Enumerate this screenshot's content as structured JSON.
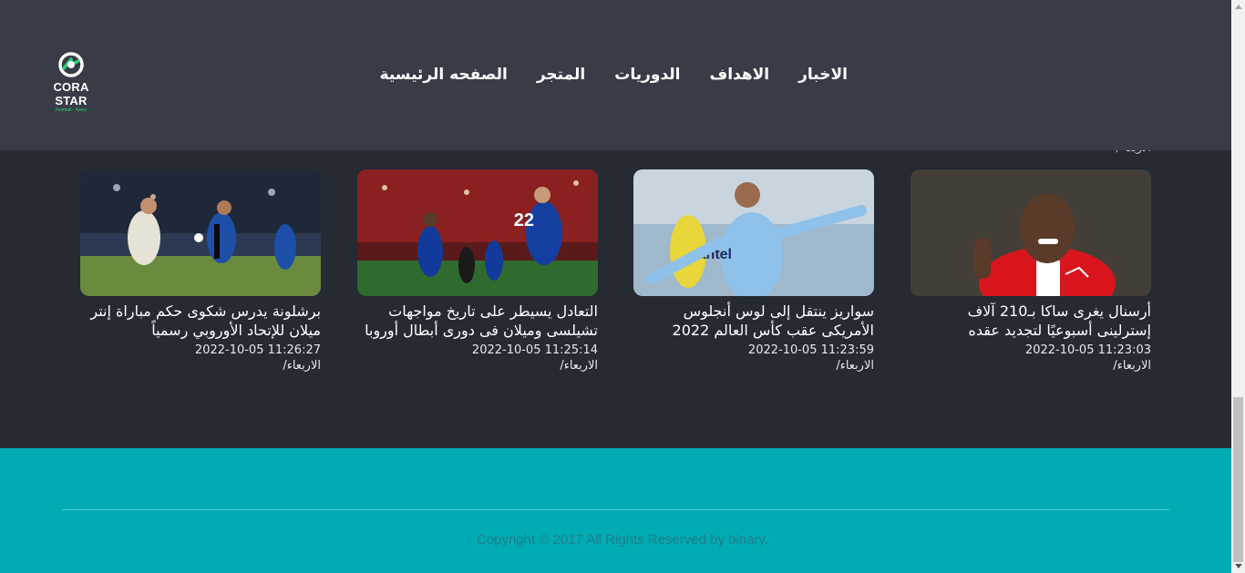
{
  "brand": {
    "name": "CORA STAR",
    "tagline": "Football - News"
  },
  "nav": [
    {
      "label": "الصفحه الرئيسية"
    },
    {
      "label": "المتجر"
    },
    {
      "label": "الدوريات"
    },
    {
      "label": "الاهداف"
    },
    {
      "label": "الاخبار"
    }
  ],
  "cutoff_text": "الاربعاء/",
  "cards": [
    {
      "title": "أرسنال يغرى ساكا بـ210 آلاف إسترلينى أسبوعيًا لتجديد عقده",
      "time": "2022-10-05 11:23:03",
      "day": "الاربعاء/"
    },
    {
      "title": "سواريز ينتقل إلى لوس أنجلوس الأمريكى عقب كأس العالم 2022",
      "time": "2022-10-05 11:23:59",
      "day": "الاربعاء/"
    },
    {
      "title": "التعادل يسيطر على تاريخ مواجهات تشيلسى وميلان فى دورى أبطال أوروبا",
      "time": "2022-10-05 11:25:14",
      "day": "الاربعاء/"
    },
    {
      "title": "برشلونة يدرس شكوى حكم مباراة إنتر ميلان للإتحاد الأوروبي رسمياً",
      "time": "2022-10-05 11:26:27",
      "day": "الاربعاء/"
    }
  ],
  "footer": {
    "copyright": "Copyright © 2017 All Rights Reserved by binary."
  },
  "colors": {
    "header": "#373c46",
    "body": "#252a33",
    "footer": "#00abb4",
    "accent": "#2ecc71"
  }
}
